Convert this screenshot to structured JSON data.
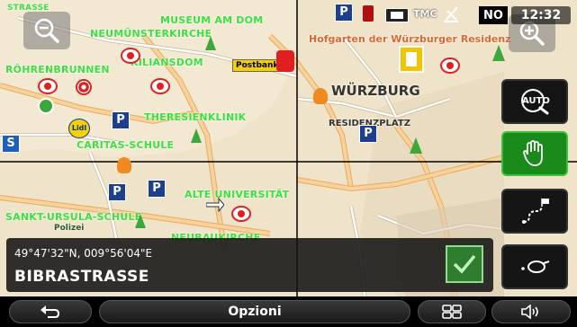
{
  "status": {
    "tmc": "TMC",
    "heading": "NO",
    "time": "12:32"
  },
  "map": {
    "city": "WÜRZBURG",
    "square": "RESIDENZPLATZ",
    "postbank": "Postbank",
    "hofgarten": "Hofgarten der Würzburger Residenz",
    "labels": [
      "MUSEUM AM DOM",
      "NEUMÜNSTERKIRCHE",
      "KILIANSDOM",
      "RÖHRENBRUNNEN",
      "THERESIENKLINIK",
      "CARITAS-SCHULE",
      "ALTE UNIVERSITÄT",
      "SANKT-URSULA-SCHULE",
      "NEUBAUKIRCHE",
      "STRASSE"
    ],
    "parking": "P",
    "lidl": "Lidl",
    "s_sign": "S",
    "police": "Polizei"
  },
  "info": {
    "coordinates": "49°47'32\"N, 009°56'04\"E",
    "street": "BIBRASTRASSE"
  },
  "side_buttons": {
    "auto_label": "AUTO"
  },
  "bottom": {
    "options_label": "Opzioni"
  },
  "colors": {
    "poi_green": "#3ce03c",
    "accent_green": "#1a8a1a",
    "parking_blue": "#1d3f8f"
  }
}
